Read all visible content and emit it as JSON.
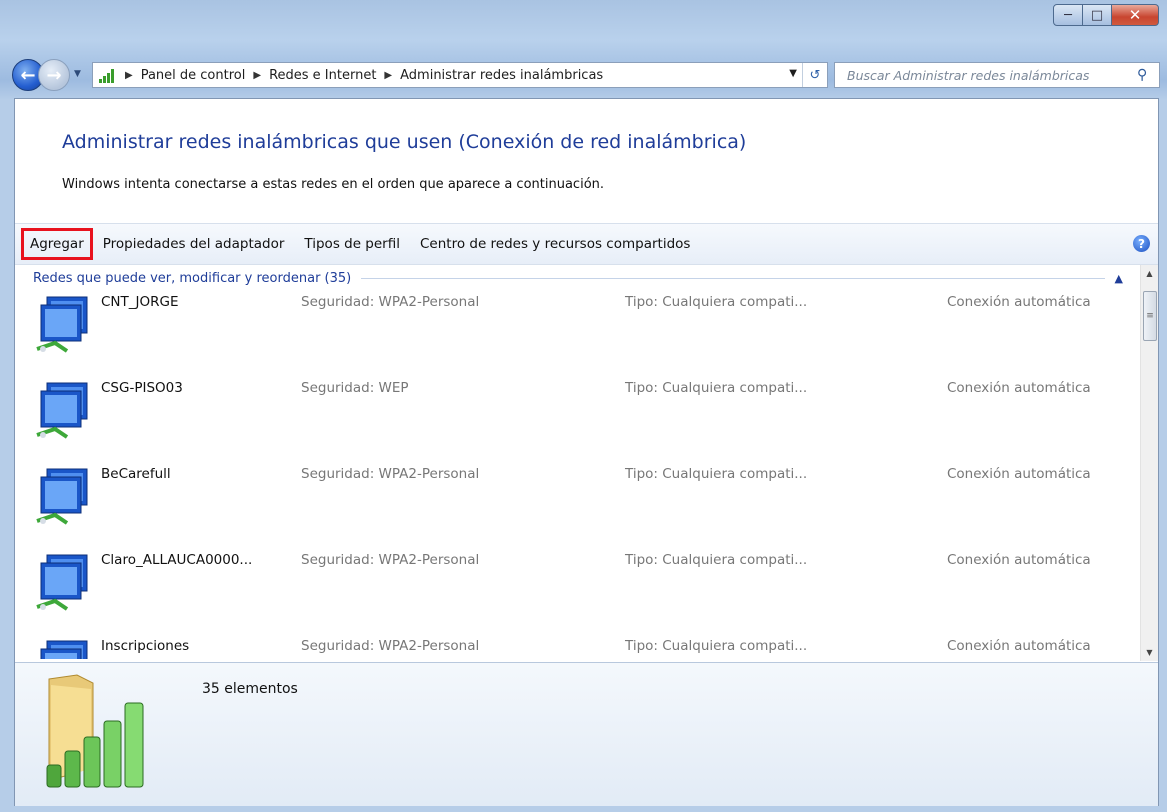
{
  "window": {
    "caption": {
      "minimize_icon": "minimize-icon",
      "maximize_icon": "maximize-icon",
      "close_icon": "close-icon"
    }
  },
  "nav": {
    "breadcrumbs": [
      "Panel de control",
      "Redes e Internet",
      "Administrar redes inalámbricas"
    ],
    "search_placeholder": "Buscar Administrar redes inalámbricas"
  },
  "main": {
    "heading": "Administrar redes inalámbricas que usen (Conexión de red inalámbrica)",
    "intro": "Windows intenta conectarse a estas redes en el orden que aparece a continuación."
  },
  "toolbar": {
    "items": [
      "Agregar",
      "Propiedades del adaptador",
      "Tipos de perfil",
      "Centro de redes y recursos compartidos"
    ]
  },
  "group": {
    "title": "Redes que puede ver, modificar y reordenar (35)"
  },
  "networks": [
    {
      "name": "CNT_JORGE",
      "security": "Seguridad: WPA2-Personal",
      "type": "Tipo: Cualquiera compati...",
      "mode": "Conexión automática"
    },
    {
      "name": "CSG-PISO03",
      "security": "Seguridad: WEP",
      "type": "Tipo: Cualquiera compati...",
      "mode": "Conexión automática"
    },
    {
      "name": "BeCarefull",
      "security": "Seguridad: WPA2-Personal",
      "type": "Tipo: Cualquiera compati...",
      "mode": "Conexión automática"
    },
    {
      "name": "Claro_ALLAUCA0000...",
      "security": "Seguridad: WPA2-Personal",
      "type": "Tipo: Cualquiera compati...",
      "mode": "Conexión automática"
    },
    {
      "name": "Inscripciones",
      "security": "Seguridad: WPA2-Personal",
      "type": "Tipo: Cualquiera compati...",
      "mode": "Conexión automática"
    }
  ],
  "details": {
    "count": "35 elementos"
  },
  "colors": {
    "highlight": "#e8121e",
    "link": "#1f3d99",
    "toolbar_bg": "#eef3fa"
  }
}
